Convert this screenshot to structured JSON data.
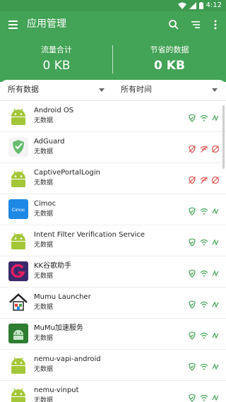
{
  "statusbar": {
    "time": "4:12"
  },
  "appbar": {
    "title": "应用管理"
  },
  "summary": {
    "total_label": "流量合计",
    "total_value": "0 KB",
    "saved_label": "节省的数据",
    "saved_value": "0 KB"
  },
  "filters": {
    "data_filter": "所有数据",
    "time_filter": "所有时间"
  },
  "colors": {
    "green": "#43a356",
    "red": "#d9534f",
    "white": "#ffffff"
  },
  "apps": [
    {
      "name": "Android OS",
      "status": "无数据",
      "icon": "android-icon",
      "blocked": false
    },
    {
      "name": "AdGuard",
      "status": "无数据",
      "icon": "adguard-shield-icon",
      "blocked": true
    },
    {
      "name": "CaptivePortalLogin",
      "status": "无数据",
      "icon": "android-icon",
      "blocked": true
    },
    {
      "name": "Cimoc",
      "status": "无数据",
      "icon_text": "Cimoc",
      "icon": "cimoc-icon",
      "blocked": false
    },
    {
      "name": "Intent Filter Verification Service",
      "status": "无数据",
      "icon": "android-icon",
      "blocked": false
    },
    {
      "name": "KK谷歌助手",
      "status": "无数据",
      "icon": "kk-g-icon",
      "blocked": false
    },
    {
      "name": "Mumu Launcher",
      "status": "无数据",
      "icon": "house-icon",
      "blocked": false
    },
    {
      "name": "MuMu加速服务",
      "status": "无数据",
      "icon": "mumu-android-icon",
      "blocked": false
    },
    {
      "name": "nemu-vapi-android",
      "status": "无数据",
      "icon": "android-icon",
      "blocked": false
    },
    {
      "name": "nemu-vinput",
      "status": "无数据",
      "icon": "android-icon",
      "blocked": false
    }
  ]
}
